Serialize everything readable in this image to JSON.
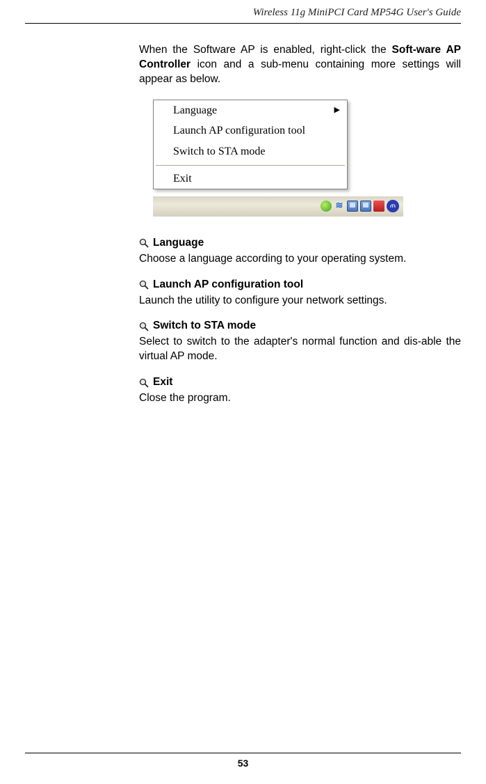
{
  "header": "Wireless 11g MiniPCI Card MP54G User's Guide",
  "page_number": "53",
  "intro": {
    "pre": "When the Software AP is enabled, right-click the ",
    "bold": "Soft-ware AP Controller",
    "post": " icon and a sub-menu containing more settings will appear as below."
  },
  "menu": {
    "items": [
      "Language",
      "Launch AP configuration tool",
      "Switch to STA mode"
    ],
    "exit": "Exit"
  },
  "tray": {
    "m_label": "ጠ"
  },
  "sections": [
    {
      "title": "Language",
      "body": "Choose a language according to your operating system."
    },
    {
      "title": "Launch AP configuration tool",
      "body": "Launch the utility to configure your network settings."
    },
    {
      "title": "Switch to STA mode",
      "body": "Select to switch to the adapter's normal function and dis-able the virtual AP mode."
    },
    {
      "title": "Exit",
      "body": "Close the program."
    }
  ]
}
